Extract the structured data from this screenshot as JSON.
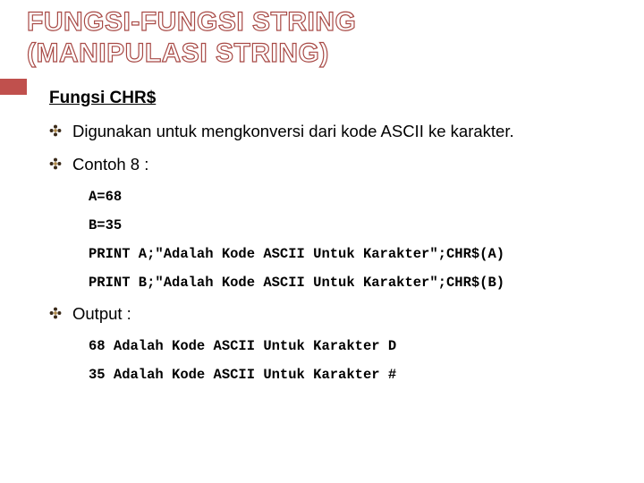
{
  "title": {
    "line1": "FUNGSI-FUNGSI STRING",
    "line2": "(MANIPULASI STRING)"
  },
  "section_heading": "Fungsi CHR$",
  "bullets": {
    "desc": "Digunakan untuk mengkonversi dari kode ASCII ke karakter.",
    "example_label": "Contoh 8 :",
    "output_label": "Output :"
  },
  "code": {
    "l1": "A=68",
    "l2": "B=35",
    "l3": "PRINT A;\"Adalah Kode ASCII Untuk Karakter\";CHR$(A)",
    "l4": "PRINT B;\"Adalah Kode ASCII Untuk Karakter\";CHR$(B)"
  },
  "output": {
    "l1": "68 Adalah Kode ASCII Untuk Karakter D",
    "l2": "35 Adalah Kode ASCII Untuk Karakter #"
  }
}
